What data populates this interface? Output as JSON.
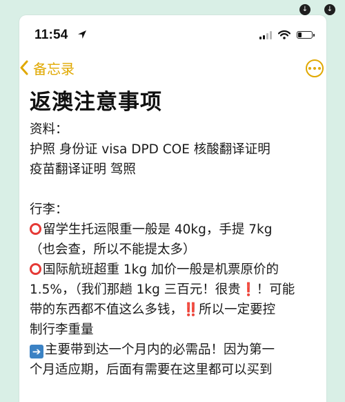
{
  "status": {
    "time": "11:54"
  },
  "nav": {
    "back_label": "备忘录"
  },
  "note": {
    "title": "返澳注意事项",
    "lines": [
      "资料：",
      "护照 身份证 visa DPD  COE  核酸翻译证明",
      "疫苗翻译证明 驾照",
      "",
      "行李：",
      "留学生托运限重一般是 40kg，手提 7kg",
      "（也会查，所以不能提太多）",
      "国际航班超重 1kg 加价一般是机票原价的",
      "1.5%，（我们那趟 1kg 三百元！很贵",
      "带的东西都不值这么多钱，",
      "所以一定要控",
      "制行李重量",
      "主要带到达一个月内的必需品！因为第一",
      "个月适应期，后面有需要在这里都可以买到",
      "！",
      "！可能",
      "‼️"
    ]
  },
  "icons": [
    "location-arrow-icon",
    "signal-icon",
    "wifi-icon",
    "battery-icon",
    "chevron-left-icon",
    "more-icon",
    "circle-mark-icon",
    "arrow-right-icon",
    "exclamation-icon",
    "double-exclamation-icon"
  ],
  "colors": {
    "accent": "#e0a800",
    "background": "#d9efe6",
    "mark_red": "#e53935",
    "arrow_blue": "#3b82c4"
  },
  "battery_level": 0.25
}
